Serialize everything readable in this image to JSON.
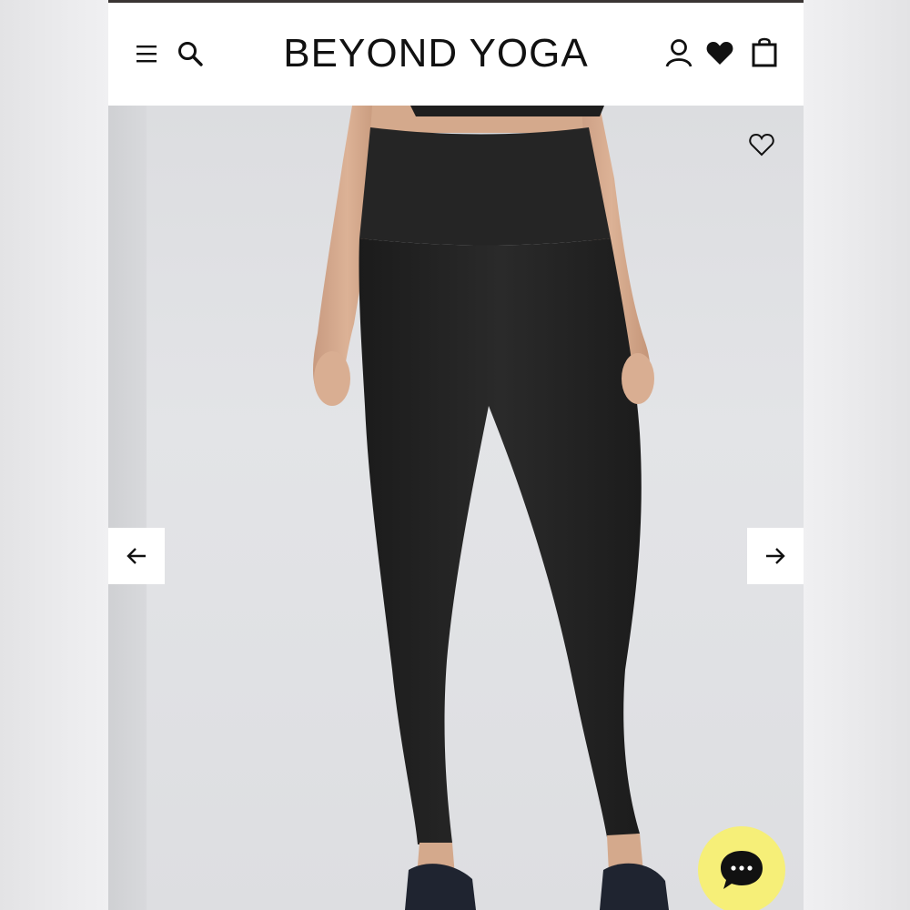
{
  "header": {
    "brand": "BEYOND YOGA",
    "icons": {
      "menu": "menu-icon",
      "search": "search-icon",
      "account": "account-icon",
      "wishlist": "heart-filled-icon",
      "cart": "shopping-bag-icon"
    }
  },
  "product_image": {
    "subject": "product-photo",
    "wishlist_icon": "heart-outline-icon",
    "prev_icon": "arrow-left-icon",
    "next_icon": "arrow-right-icon"
  },
  "chat": {
    "icon": "chat-bubble-icon",
    "accent": "#f6ef78"
  },
  "colors": {
    "text": "#111111",
    "top_rule": "#3a3533",
    "background": "#ffffff",
    "legging": "#222222"
  }
}
